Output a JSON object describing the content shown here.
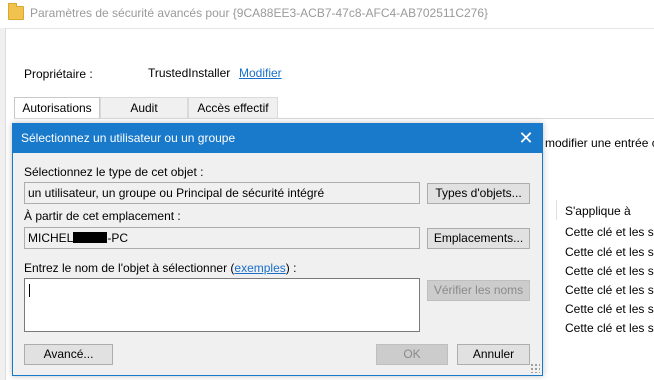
{
  "background_window": {
    "title": "Paramètres de sécurité avancés pour {9CA88EE3-ACB7-47c8-AFC4-AB702511C276}",
    "owner_label": "Propriétaire :",
    "owner_value": "TrustedInstaller",
    "owner_link": "Modifier",
    "tabs": [
      {
        "label": "Autorisations",
        "active": true
      },
      {
        "label": "Audit",
        "active": false
      },
      {
        "label": "Accès effectif",
        "active": false
      }
    ],
    "partial_text": "modifier une entrée c",
    "applies_header": "S'applique à",
    "applies_rows": [
      "Cette clé et les sc",
      "Cette clé et les sc",
      "Cette clé et les sc",
      "Cette clé et les sc",
      "Cette clé et les sc",
      "Cette clé et les sc"
    ]
  },
  "dialog": {
    "title": "Sélectionnez un utilisateur ou un groupe",
    "close_icon": "close-icon",
    "object_type_label": "Sélectionnez le type de cet objet :",
    "object_type_value": "un utilisateur, un groupe ou Principal de sécurité intégré",
    "object_types_button": "Types d'objets...",
    "location_label": "À partir de cet emplacement :",
    "location_value_prefix": "MICHEL",
    "location_value_suffix": "-PC",
    "locations_button": "Emplacements...",
    "name_label_prefix": "Entrez le nom de l'objet à sélectionner (",
    "name_label_link": "exemples",
    "name_label_suffix": ") :",
    "name_value": "",
    "check_names_button": "Vérifier les noms",
    "advanced_button": "Avancé...",
    "ok_button": "OK",
    "cancel_button": "Annuler"
  },
  "colors": {
    "accent": "#1979ca",
    "link": "#1a6fc9"
  }
}
